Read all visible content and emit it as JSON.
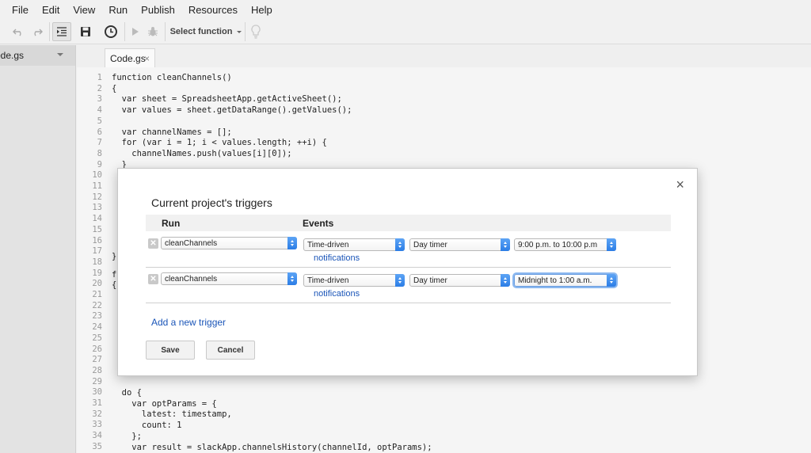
{
  "menu": [
    "File",
    "Edit",
    "View",
    "Run",
    "Publish",
    "Resources",
    "Help"
  ],
  "toolbar": {
    "select_function_label": "Select function"
  },
  "files": {
    "current": "ode.gs"
  },
  "tabs": [
    {
      "label": "Code.gs",
      "close": "×"
    }
  ],
  "editor": {
    "line_numbers": [
      "1",
      "2",
      "3",
      "4",
      "5",
      "6",
      "7",
      "8",
      "9",
      "10",
      "11",
      "12",
      "13",
      "14",
      "15",
      "16",
      "17",
      "18",
      "19",
      "20",
      "21",
      "22",
      "23",
      "24",
      "25",
      "26",
      "27",
      "28",
      "29",
      "30",
      "31",
      "32",
      "33",
      "34",
      "35"
    ],
    "lines_top": [
      "function cleanChannels()",
      "{",
      "  var sheet = SpreadsheetApp.getActiveSheet();",
      "  var values = sheet.getDataRange().getValues();",
      "",
      "  var channelNames = [];",
      "  for (var i = 1; i < values.length; ++i) {",
      "    channelNames.push(values[i][0]);",
      "  }"
    ],
    "line_17": "}",
    "line_19": "f",
    "line_20": "{",
    "lines_bottom": [
      "  do {",
      "    var optParams = {",
      "      latest: timestamp,",
      "      count: 1",
      "    };",
      "    var result = slackApp.channelsHistory(channelId, optParams);"
    ]
  },
  "dialog": {
    "title": "Current project's triggers",
    "close": "×",
    "headers": {
      "run": "Run",
      "events": "Events"
    },
    "triggers": [
      {
        "delete": "✕",
        "run": "cleanChannels",
        "event_source": "Time-driven",
        "timer_type": "Day timer",
        "time_range": "9:00 p.m. to 10:00 p.m",
        "notifications": "notifications"
      },
      {
        "delete": "✕",
        "run": "cleanChannels",
        "event_source": "Time-driven",
        "timer_type": "Day timer",
        "time_range": "Midnight to 1:00 a.m.",
        "notifications": "notifications"
      }
    ],
    "add_trigger": "Add a new trigger",
    "save": "Save",
    "cancel": "Cancel"
  }
}
